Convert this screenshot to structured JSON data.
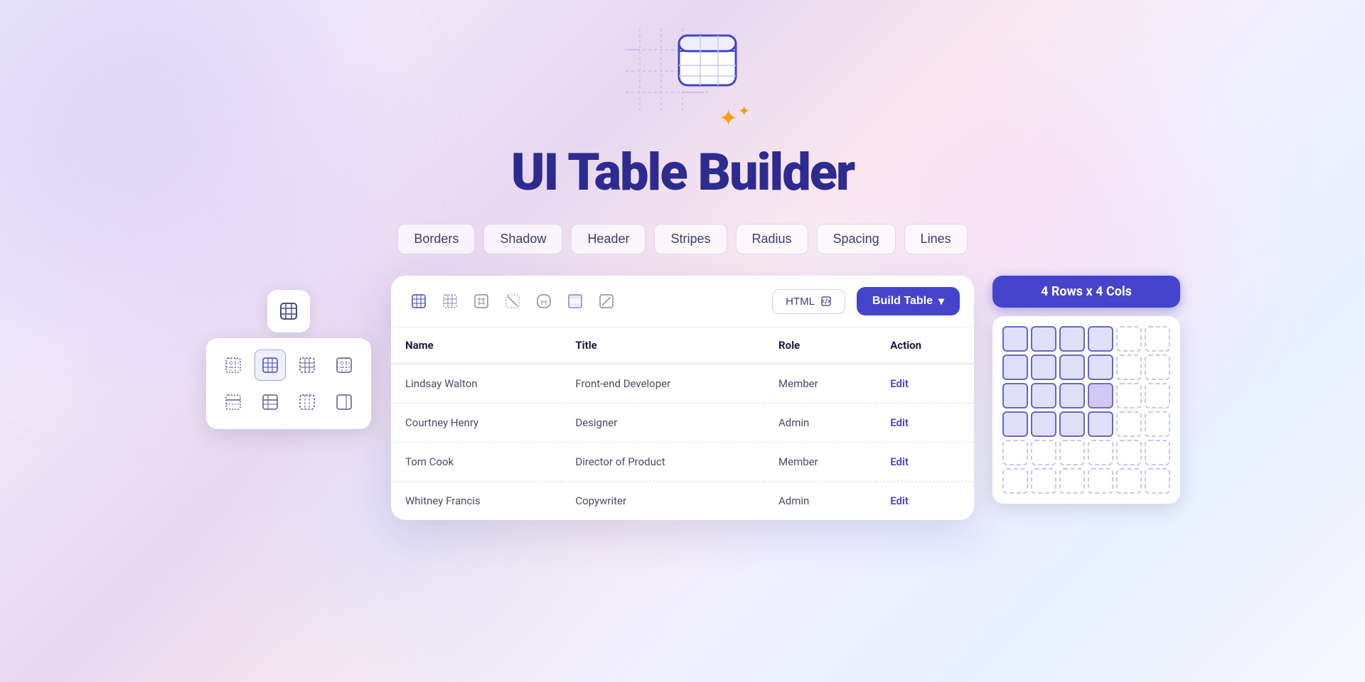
{
  "page": {
    "title": "UI Table Builder",
    "background": "#e8e8f8"
  },
  "hero": {
    "sparkle1": "✦",
    "sparkle2": "✦"
  },
  "filters": {
    "pills": [
      {
        "label": "Borders",
        "id": "borders"
      },
      {
        "label": "Shadow",
        "id": "shadow"
      },
      {
        "label": "Header",
        "id": "header"
      },
      {
        "label": "Stripes",
        "id": "stripes"
      },
      {
        "label": "Radius",
        "id": "radius"
      },
      {
        "label": "Spacing",
        "id": "spacing"
      },
      {
        "label": "Lines",
        "id": "lines"
      }
    ]
  },
  "toolbar": {
    "buttons": [
      {
        "icon": "⊞",
        "label": "full-grid",
        "active": false
      },
      {
        "icon": "⊞",
        "label": "inner-borders",
        "active": false
      },
      {
        "icon": "▦",
        "label": "header-only",
        "active": false
      },
      {
        "icon": "✕",
        "label": "no-borders",
        "active": false
      },
      {
        "icon": "⌐",
        "label": "rounded",
        "active": false
      },
      {
        "icon": "≡",
        "label": "stripes",
        "active": false
      },
      {
        "icon": "╱",
        "label": "diagonal",
        "active": false
      }
    ],
    "html_label": "HTML",
    "build_label": "Build Table",
    "build_chevron": "▾"
  },
  "table": {
    "headers": [
      "Name",
      "Title",
      "Role",
      "Action"
    ],
    "rows": [
      {
        "name": "Lindsay Walton",
        "title": "Front-end Developer",
        "role": "Member",
        "action": "Edit"
      },
      {
        "name": "Courtney Henry",
        "title": "Designer",
        "role": "Admin",
        "action": "Edit"
      },
      {
        "name": "Tom Cook",
        "title": "Director of Product",
        "role": "Member",
        "action": "Edit"
      },
      {
        "name": "Whitney Francis",
        "title": "Copywriter",
        "role": "Admin",
        "action": "Edit"
      }
    ]
  },
  "grid_selector": {
    "label": "4 Rows x 4 Cols",
    "rows": 6,
    "cols": 6,
    "selected_rows": 4,
    "selected_cols": 4
  },
  "icon_grid": {
    "items": [
      "⠿",
      "⊞",
      "⊡",
      "⊟",
      "⊞",
      "⊟",
      "⊡",
      "⊞"
    ]
  }
}
